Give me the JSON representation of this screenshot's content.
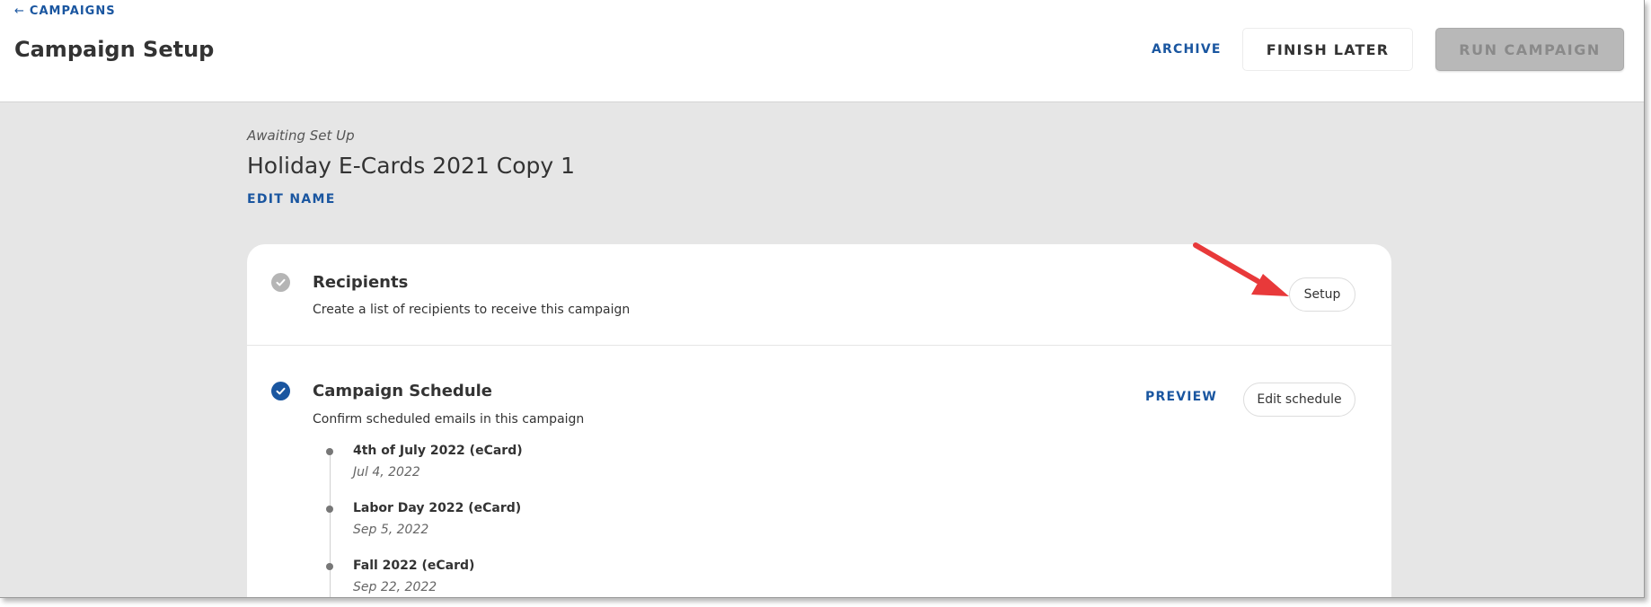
{
  "header": {
    "back_link": "CAMPAIGNS",
    "back_arrow": "←",
    "page_title": "Campaign Setup",
    "archive_label": "ARCHIVE",
    "finish_later_label": "FINISH LATER",
    "run_campaign_label": "RUN CAMPAIGN"
  },
  "campaign": {
    "status": "Awaiting Set Up",
    "name": "Holiday E-Cards 2021 Copy 1",
    "edit_name_label": "EDIT NAME"
  },
  "recipients": {
    "title": "Recipients",
    "description": "Create a list of recipients to receive this campaign",
    "setup_label": "Setup",
    "status_icon": "check-circle-gray-icon"
  },
  "schedule": {
    "title": "Campaign Schedule",
    "description": "Confirm scheduled emails in this campaign",
    "preview_label": "PREVIEW",
    "edit_schedule_label": "Edit schedule",
    "status_icon": "check-circle-blue-icon",
    "items": [
      {
        "name": "4th of July 2022 (eCard)",
        "date": "Jul 4, 2022"
      },
      {
        "name": "Labor Day 2022 (eCard)",
        "date": "Sep 5, 2022"
      },
      {
        "name": "Fall 2022 (eCard)",
        "date": "Sep 22, 2022"
      }
    ]
  },
  "colors": {
    "accent": "#1a56a0",
    "annotation_arrow": "#e8393a",
    "content_background": "#e6e6e6",
    "disabled_button": "#b8b8b8"
  }
}
